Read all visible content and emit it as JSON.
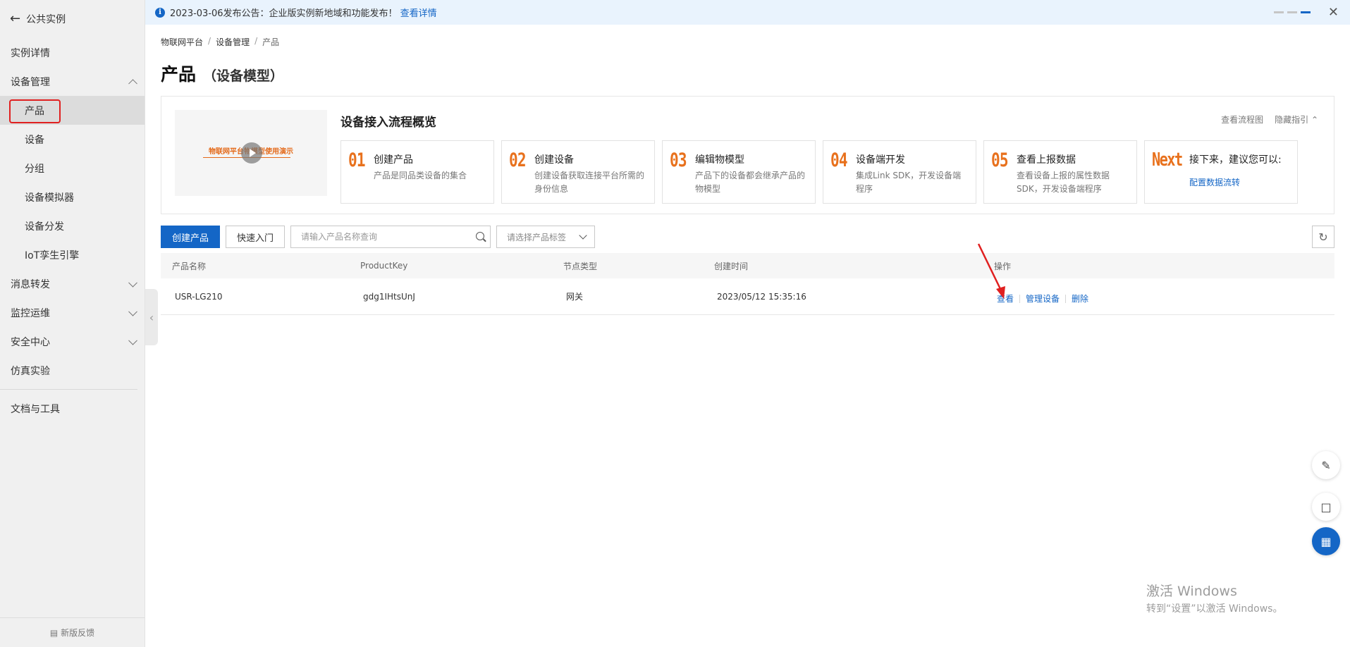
{
  "sidebar": {
    "back_label": "公共实例",
    "items": [
      {
        "label": "实例详情"
      },
      {
        "label": "设备管理"
      },
      {
        "label": "产品"
      },
      {
        "label": "设备"
      },
      {
        "label": "分组"
      },
      {
        "label": "设备模拟器"
      },
      {
        "label": "设备分发"
      },
      {
        "label": "IoT孪生引擎"
      },
      {
        "label": "消息转发"
      },
      {
        "label": "监控运维"
      },
      {
        "label": "安全中心"
      },
      {
        "label": "仿真实验"
      },
      {
        "label": "文档与工具"
      }
    ],
    "active_item": "产品",
    "footer_label": "新版反馈"
  },
  "notice": {
    "text": "2023-03-06发布公告：企业版实例新地域和功能发布！",
    "link": "查看详情"
  },
  "breadcrumb": [
    "物联网平台",
    "设备管理",
    "产品"
  ],
  "page_title": {
    "main": "产品",
    "sub": "（设备模型）"
  },
  "guide": {
    "video_text": "物联网平台物模型使用演示",
    "title": "设备接入流程概览",
    "link_flow": "查看流程图",
    "link_hide": "隐藏指引",
    "steps": [
      {
        "num": "01",
        "title": "创建产品",
        "desc": "产品是同品类设备的集合"
      },
      {
        "num": "02",
        "title": "创建设备",
        "desc": "创建设备获取连接平台所需的身份信息"
      },
      {
        "num": "03",
        "title": "编辑物模型",
        "desc": "产品下的设备都会继承产品的物模型"
      },
      {
        "num": "04",
        "title": "设备端开发",
        "desc": "集成Link SDK，开发设备端程序"
      },
      {
        "num": "05",
        "title": "查看上报数据",
        "desc": "查看设备上报的属性数据 SDK，开发设备端程序"
      }
    ],
    "next": {
      "num": "Next",
      "title": "接下来，建议您可以:",
      "link": "配置数据流转"
    }
  },
  "toolbar": {
    "create_label": "创建产品",
    "quickstart_label": "快速入门",
    "search_placeholder": "请输入产品名称查询",
    "tag_placeholder": "请选择产品标签"
  },
  "table": {
    "columns": [
      "产品名称",
      "ProductKey",
      "节点类型",
      "创建时间",
      "操作"
    ],
    "rows": [
      {
        "name": "USR-LG210",
        "key": "gdg1IHtsUnJ",
        "node_type": "网关",
        "created": "2023/05/12 15:35:16",
        "ops": [
          "查看",
          "管理设备",
          "删除"
        ]
      }
    ]
  },
  "watermark": {
    "line1": "激活 Windows",
    "line2": "转到“设置”以激活 Windows。"
  },
  "colors": {
    "primary": "#1466c6",
    "step_number": "#e8711d",
    "annotation": "#e02020"
  }
}
